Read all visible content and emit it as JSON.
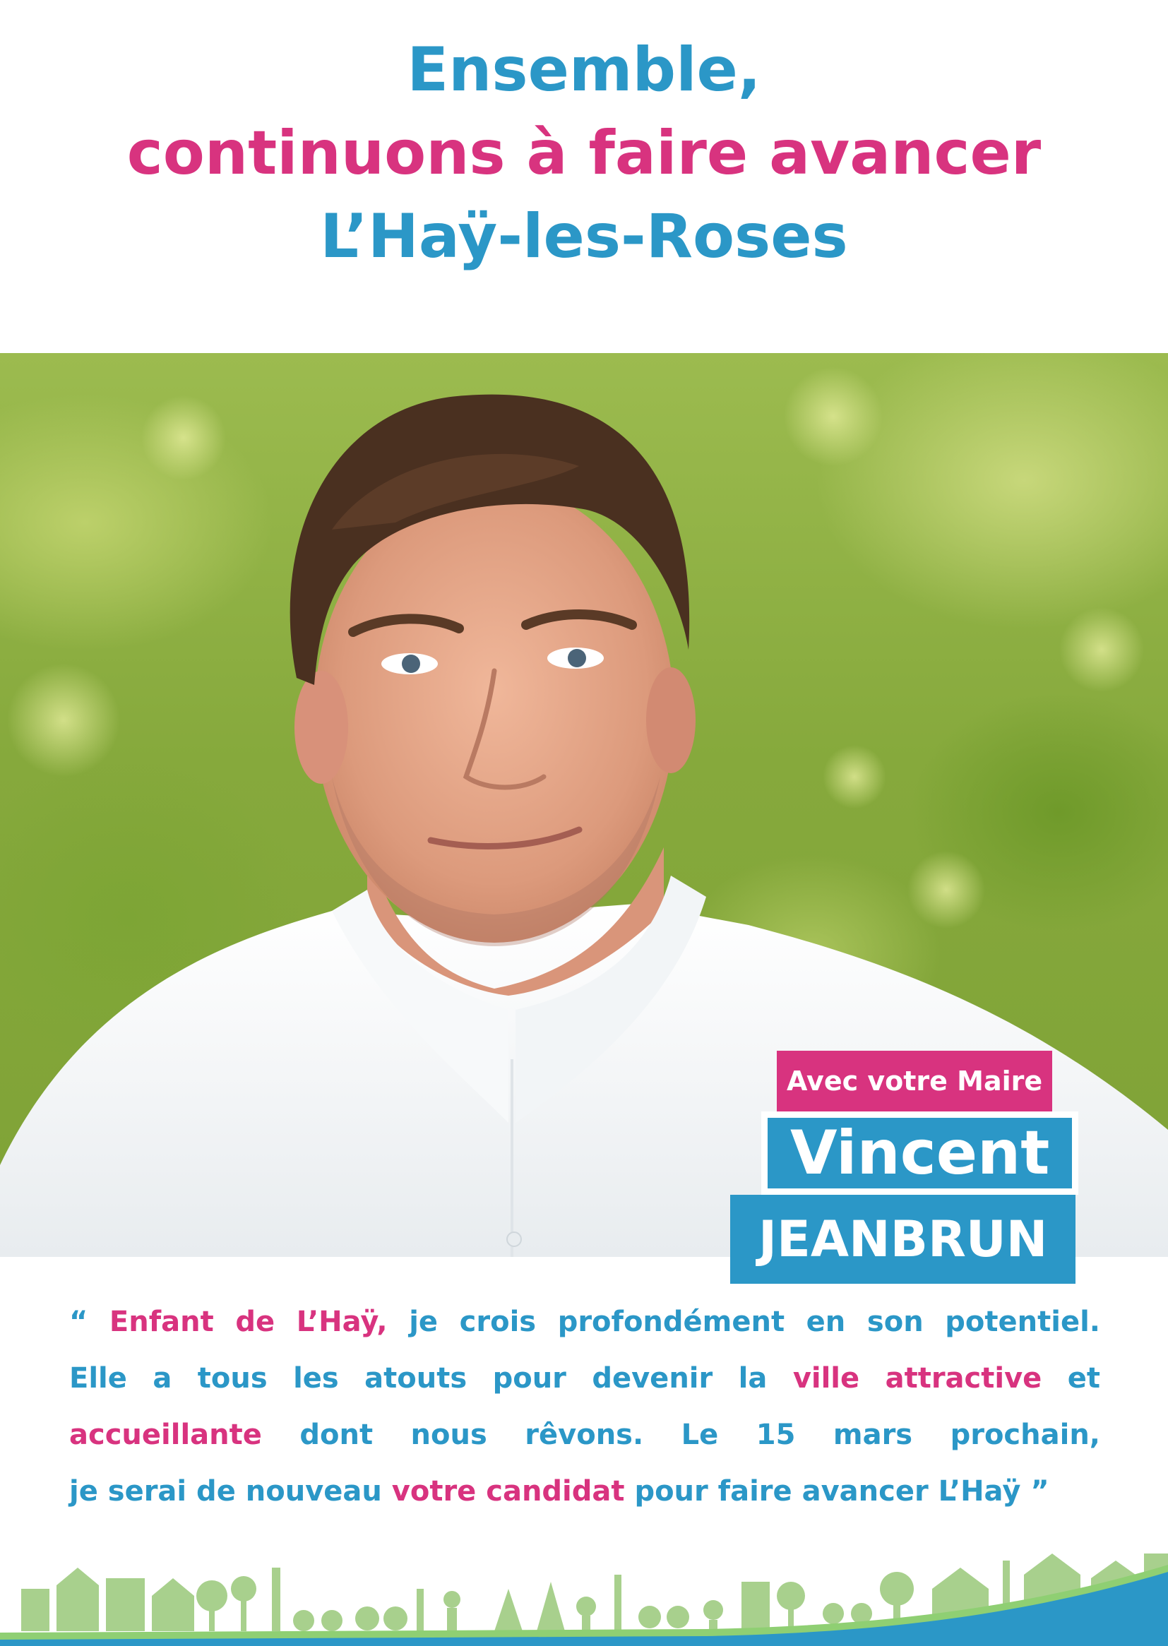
{
  "headline": {
    "line1": "Ensemble,",
    "line2": "continuons à faire avancer",
    "line3": "L’Haÿ-les-Roses"
  },
  "badge": {
    "label": "Avec votre Maire",
    "first_name": "Vincent",
    "last_name": "JEANBRUN"
  },
  "quote": {
    "l1_open": "“ ",
    "l1_hl": "Enfant de L’Haÿ,",
    "l1_rest": " je crois profondément en son potentiel.",
    "l2_a": "Elle a tous les atouts pour devenir la ",
    "l2_hl": "ville attractive",
    "l2_b": " et",
    "l3_hl": "accueillante",
    "l3_rest": " dont nous rêvons. Le 15 mars prochain,",
    "l4_a": "je serai de nouveau ",
    "l4_hl": "votre candidat",
    "l4_b": " pour faire avancer L’Haÿ ”"
  },
  "colors": {
    "blue": "#2b97c7",
    "pink": "#d8337f",
    "skyline_green": "#a8d08d"
  }
}
